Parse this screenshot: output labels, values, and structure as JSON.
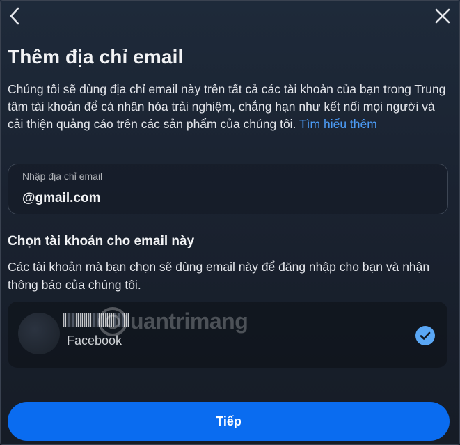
{
  "header": {
    "back_icon": "chevron-left-icon",
    "close_icon": "close-icon"
  },
  "title": "Thêm địa chỉ email",
  "description": {
    "text": "Chúng tôi sẽ dùng địa chỉ email này trên tất cả các tài khoản của bạn trong Trung tâm tài khoản để cá nhân hóa trải nghiệm, chẳng hạn như kết nối mọi người và cải thiện quảng cáo trên các sản phẩm của chúng tôi.",
    "link": "Tìm hiểu thêm"
  },
  "email_field": {
    "label": "Nhập địa chỉ email",
    "value": "@gmail.com"
  },
  "accounts_section": {
    "title": "Chọn tài khoản cho email này",
    "description": "Các tài khoản mà bạn chọn sẽ dùng email này để đăng nhập cho bạn và nhận thông báo của chúng tôi.",
    "accounts": [
      {
        "platform": "Facebook",
        "selected": true,
        "check_icon": "checkmark-circle-icon"
      }
    ]
  },
  "watermark": "uantrimang",
  "primary_button": {
    "label": "Tiếp"
  },
  "colors": {
    "accent": "#0a6cf0",
    "link": "#4c9bf5",
    "check": "#5aa7f5",
    "background": "#1a2230"
  }
}
